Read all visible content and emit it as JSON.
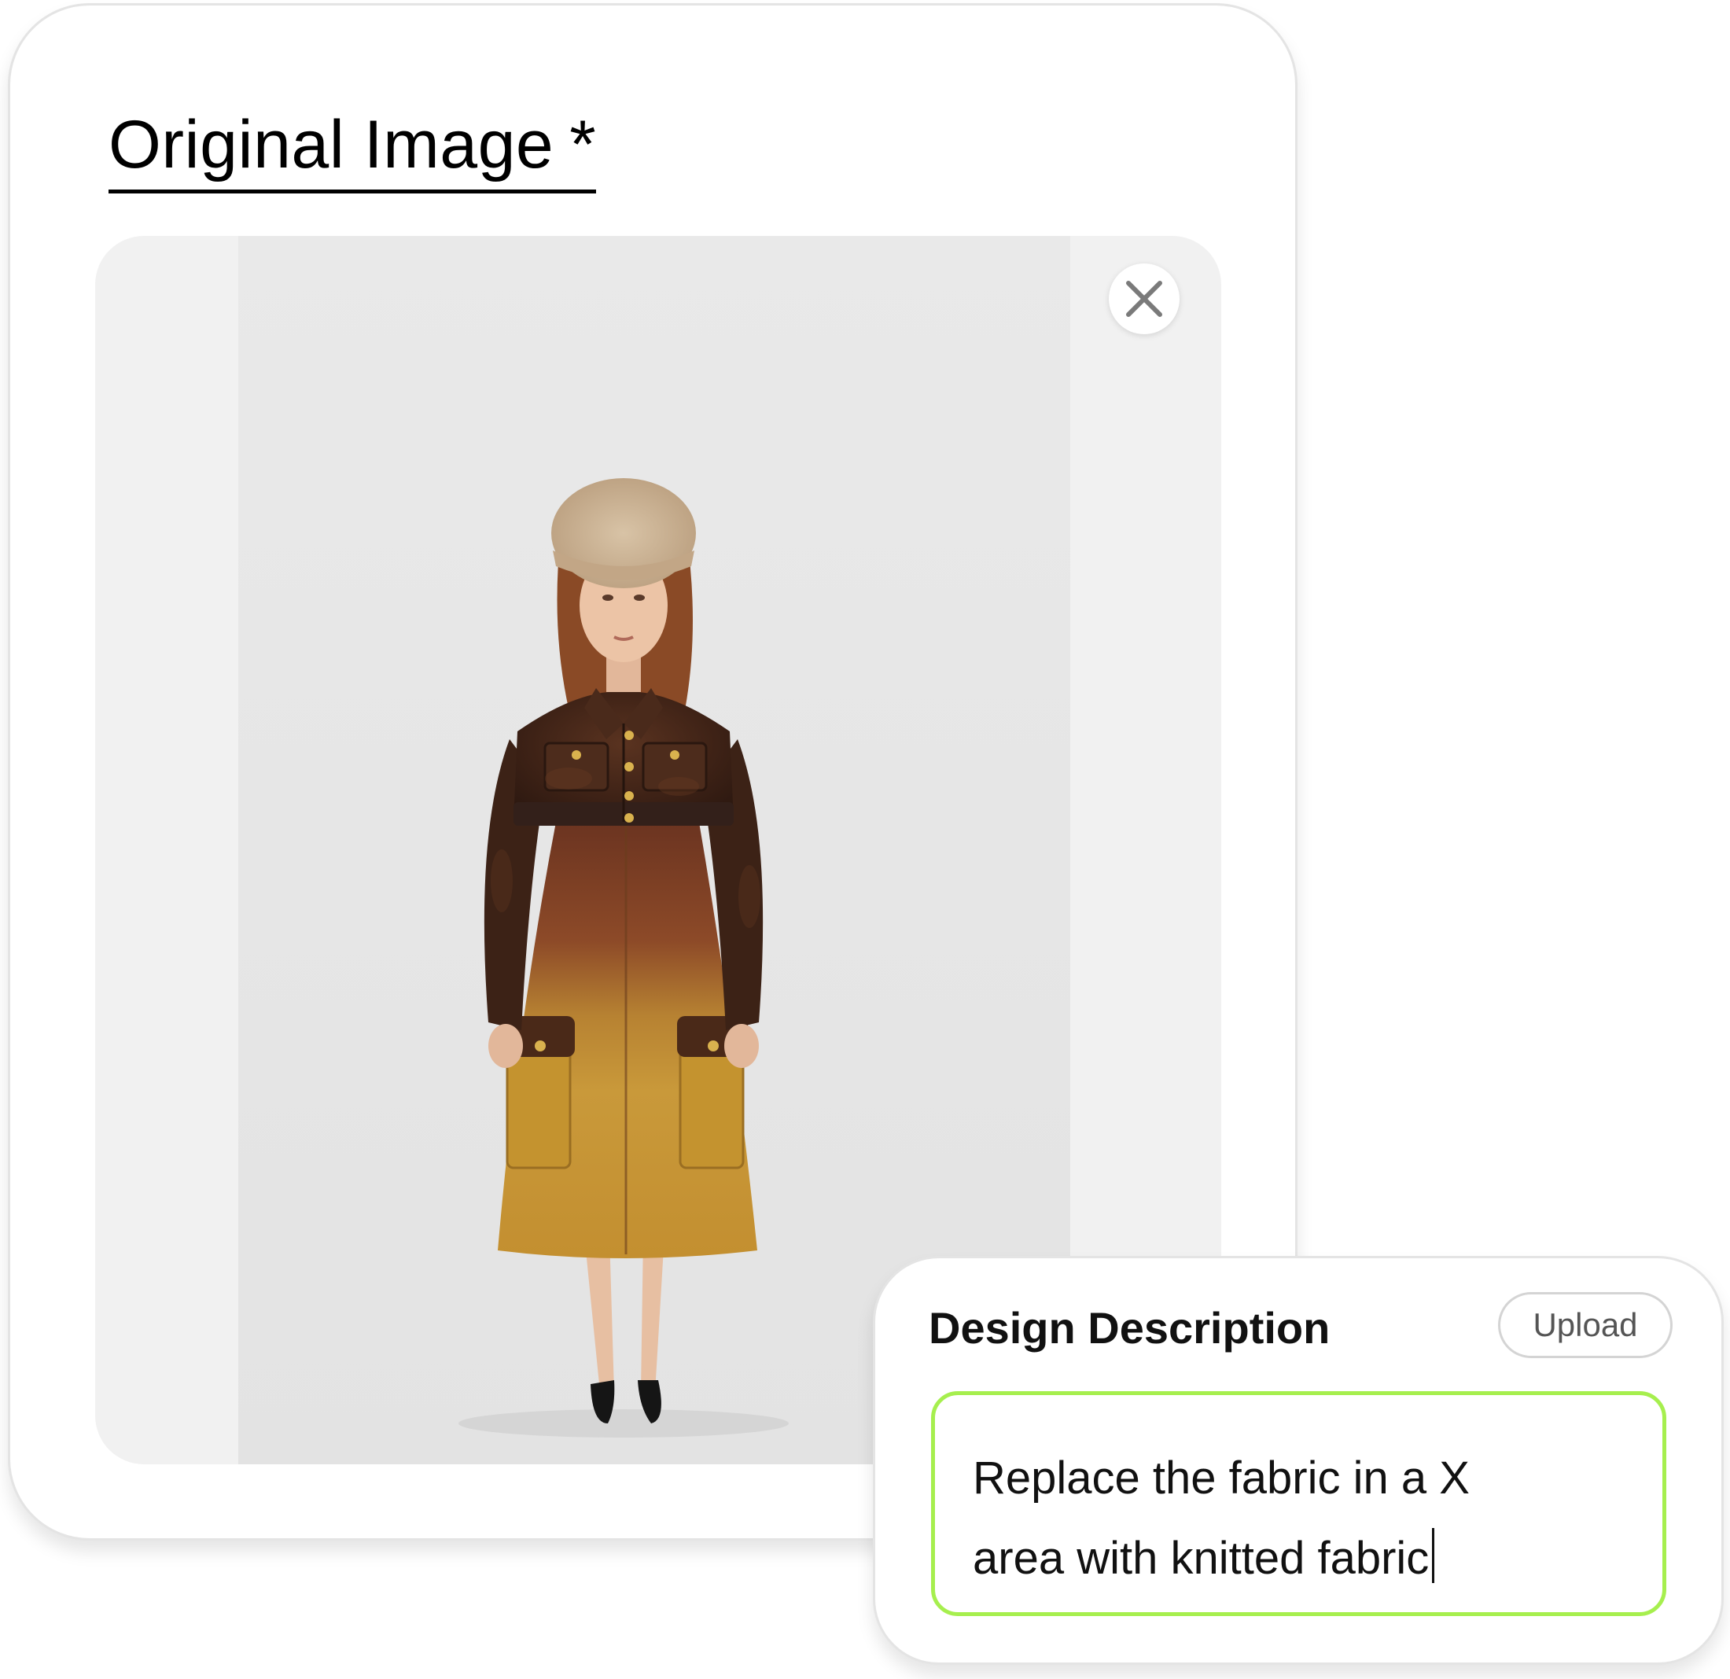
{
  "original_image": {
    "title": "Original Image",
    "required_marker": "*",
    "close_icon": "close-icon"
  },
  "design_description": {
    "heading": "Design Description",
    "upload_label": "Upload",
    "text_line_1": "Replace the fabric in a X",
    "text_line_2": "area with knitted fabric",
    "input_border_color": "#a6ef4e"
  }
}
